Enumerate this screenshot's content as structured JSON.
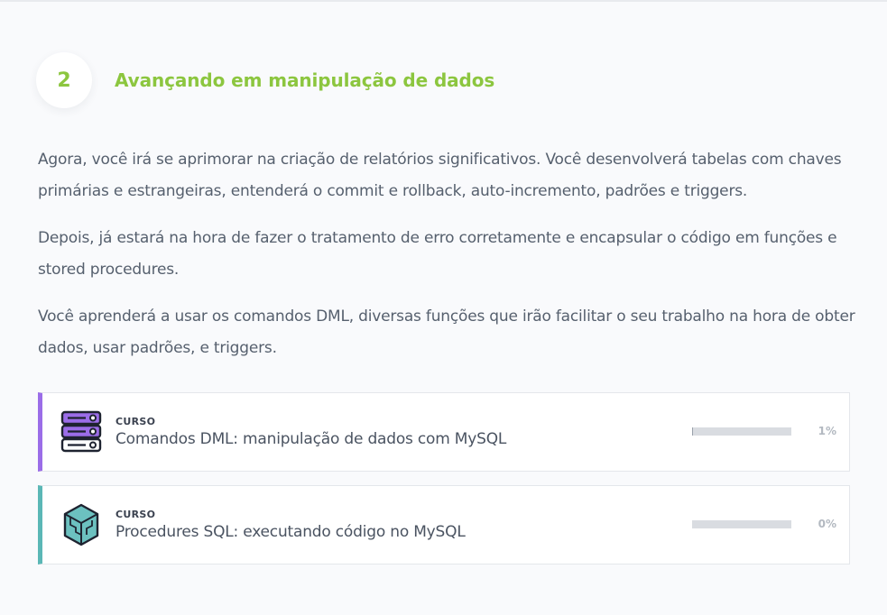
{
  "step": {
    "number": "2",
    "title": "Avançando em manipulação de dados"
  },
  "description": {
    "paragraphs": [
      "Agora, você irá se aprimorar na criação de relatórios significativos. Você desenvolverá tabelas com chaves primárias e estrangeiras, entenderá o commit e rollback, auto-incremento, padrões e triggers.",
      "Depois, já estará na hora de fazer o tratamento de erro corretamente e encapsular o código em funções e stored procedures.",
      "Você aprenderá a usar os comandos DML, diversas funções que irão facilitar o seu trabalho na hora de obter dados, usar padrões, e triggers."
    ]
  },
  "courses": [
    {
      "kind": "CURSO",
      "name": "Comandos DML: manipulação de dados com MySQL",
      "progress_label": "1%",
      "progress": 0.01,
      "accent_color": "#9b6de8",
      "icon": "database-servers-icon"
    },
    {
      "kind": "CURSO",
      "name": "Procedures SQL: executando código no MySQL",
      "progress_label": "0%",
      "progress": 0.0,
      "accent_color": "#5bb7b6",
      "icon": "cube-staircase-icon"
    }
  ]
}
